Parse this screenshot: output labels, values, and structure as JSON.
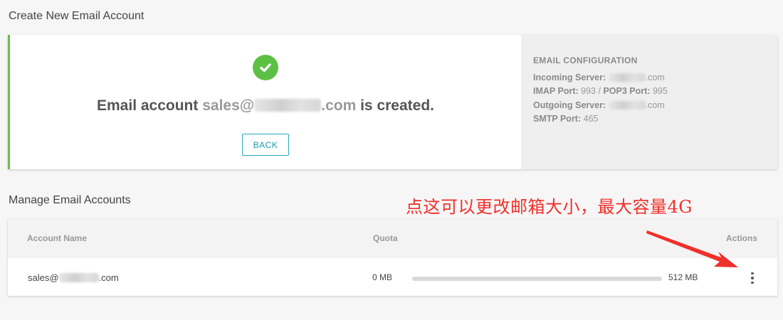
{
  "create_section": {
    "title": "Create New Email Account",
    "success_prefix": "Email account ",
    "email_user": "sales@",
    "email_suffix": ".com",
    "success_suffix": " is created.",
    "back_label": "BACK"
  },
  "config": {
    "title": "EMAIL CONFIGURATION",
    "incoming_label": "Incoming Server:",
    "incoming_suffix": ".com",
    "imap_label": "IMAP Port:",
    "imap_value": "993",
    "separator": "/",
    "pop3_label": "POP3 Port:",
    "pop3_value": "995",
    "outgoing_label": "Outgoing Server:",
    "outgoing_suffix": ".com",
    "smtp_label": "SMTP Port:",
    "smtp_value": "465"
  },
  "manage_section": {
    "title": "Manage Email Accounts",
    "columns": {
      "account": "Account Name",
      "quota": "Quota",
      "actions": "Actions"
    },
    "rows": [
      {
        "email_user": "sales@",
        "email_suffix": ".com",
        "used": "0 MB",
        "total": "512 MB",
        "usage_fraction": 0
      }
    ]
  },
  "annotation": {
    "text": "点这可以更改邮箱大小，最大容量4G"
  },
  "colors": {
    "success_green": "#5cc044",
    "accent_teal": "#29a9bd",
    "annotation_red": "#f0302a"
  },
  "icons": {
    "success": "check-circle-icon",
    "actions": "more-vertical-icon"
  }
}
